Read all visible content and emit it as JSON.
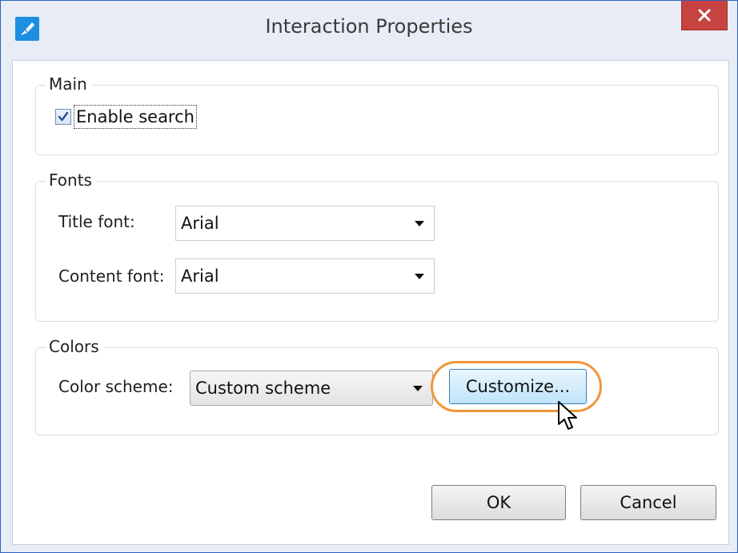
{
  "window": {
    "title": "Interaction Properties"
  },
  "main_group": {
    "title": "Main",
    "enable_search": {
      "label": "Enable search",
      "checked": true
    }
  },
  "fonts_group": {
    "title": "Fonts",
    "title_font": {
      "label": "Title font:",
      "value": "Arial"
    },
    "content_font": {
      "label": "Content font:",
      "value": "Arial"
    }
  },
  "colors_group": {
    "title": "Colors",
    "color_scheme": {
      "label": "Color scheme:",
      "value": "Custom scheme"
    },
    "customize_label": "Customize..."
  },
  "footer": {
    "ok_label": "OK",
    "cancel_label": "Cancel"
  },
  "icons": {
    "app": "brush-icon",
    "close": "close-icon",
    "dropdown": "chevron-down-icon",
    "cursor": "mouse-pointer-icon"
  },
  "colors": {
    "frame_border": "#2b5fbf",
    "close_button": "#c7433f",
    "highlight_ring": "#f0963a",
    "hover_button": "#bfe4f9"
  }
}
